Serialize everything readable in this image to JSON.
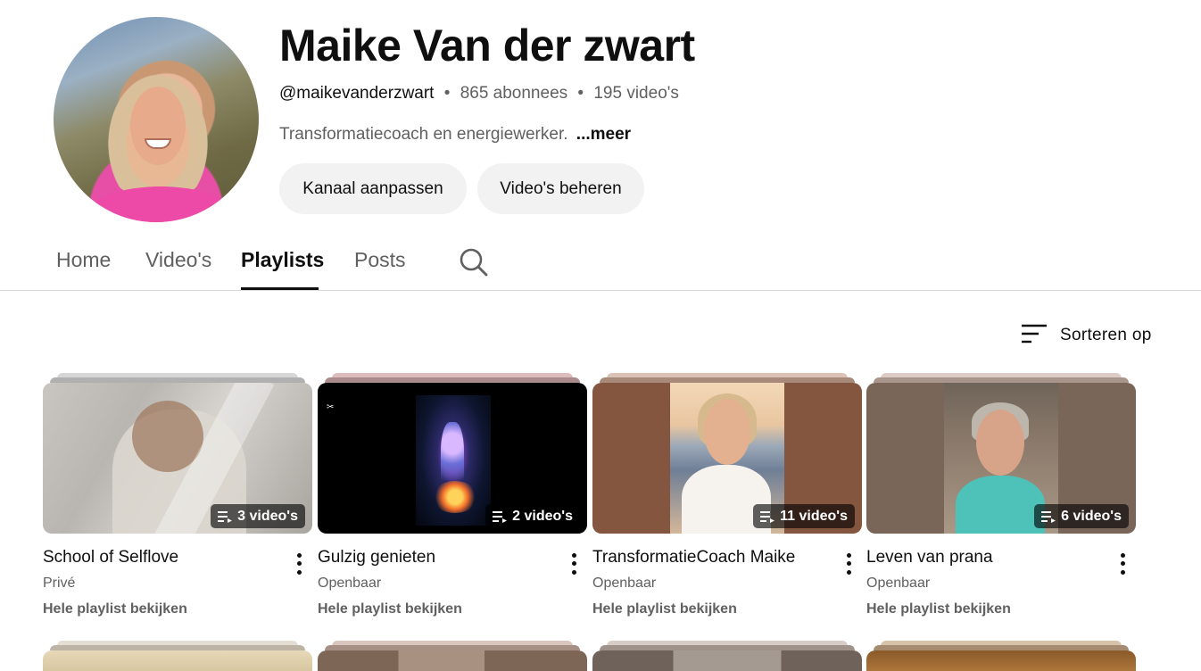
{
  "channel": {
    "name": "Maike Van der zwart",
    "handle": "@maikevanderzwart",
    "subscribers": "865 abonnees",
    "video_count": "195 video's",
    "separator": "•",
    "description": "Transformatiecoach en energiewerker.",
    "more_label": "...meer"
  },
  "buttons": {
    "edit": "Kanaal aanpassen",
    "manage": "Video's beheren"
  },
  "tabs": [
    {
      "label": "Home",
      "active": false
    },
    {
      "label": "Video's",
      "active": false
    },
    {
      "label": "Playlists",
      "active": true
    },
    {
      "label": "Posts",
      "active": false
    }
  ],
  "sort": {
    "label": "Sorteren op",
    "icon": "sort-icon"
  },
  "playlists": [
    {
      "title": "School of Selflove",
      "visibility": "Privé",
      "count": "3 video's",
      "link": "Hele playlist bekijken",
      "stack_color": "#cfcfcf",
      "stack_color2": "#a9a9a9"
    },
    {
      "title": "Gulzig genieten",
      "visibility": "Openbaar",
      "count": "2 video's",
      "link": "Hele playlist bekijken",
      "stack_color": "#d8b6b6",
      "stack_color2": "#a98a8a"
    },
    {
      "title": "TransformatieCoach Maike",
      "visibility": "Openbaar",
      "count": "11 video's",
      "link": "Hele playlist bekijken",
      "stack_color": "#d8bfb4",
      "stack_color2": "#a8897a"
    },
    {
      "title": "Leven van prana",
      "visibility": "Openbaar",
      "count": "6 video's",
      "link": "Hele playlist bekijken",
      "stack_color": "#d8c9c2",
      "stack_color2": "#a8968c"
    }
  ],
  "colors": {
    "text_primary": "#0f0f0f",
    "text_secondary": "#606060",
    "button_bg": "#f2f2f2",
    "divider": "#d9d9d9"
  }
}
